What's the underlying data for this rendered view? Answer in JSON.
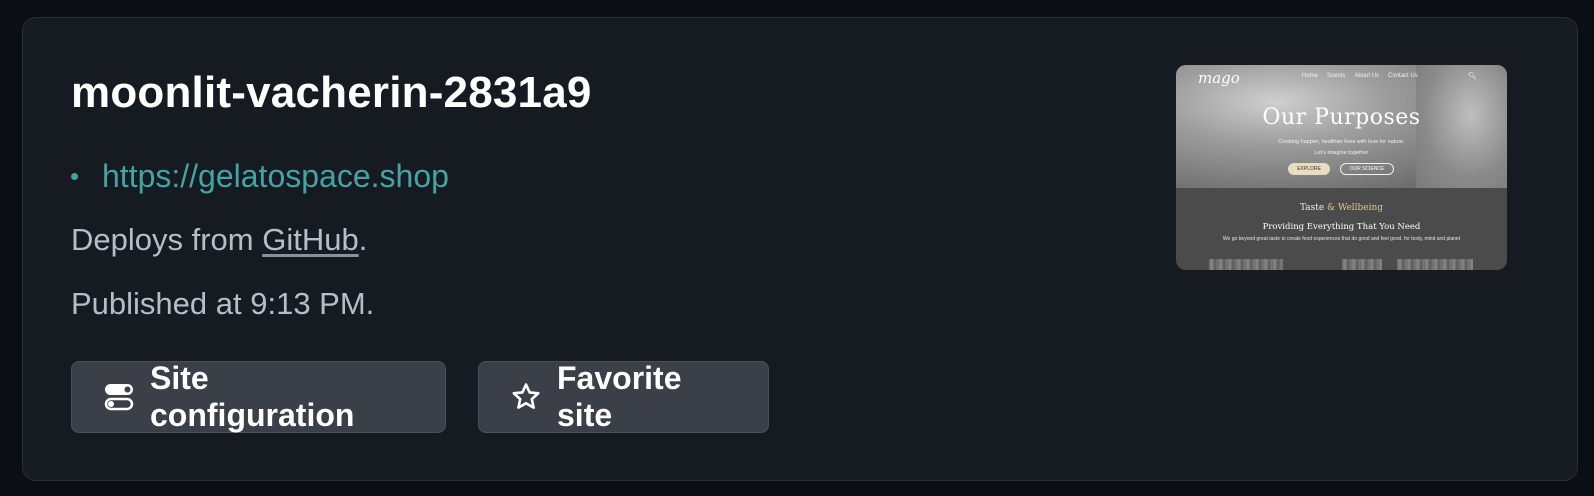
{
  "site": {
    "name": "moonlit-vacherin-2831a9",
    "url": "https://gelatospace.shop",
    "deploys_prefix": "Deploys from ",
    "deploys_source": "GitHub",
    "deploys_suffix": ".",
    "published": "Published at 9:13 PM."
  },
  "buttons": {
    "config": {
      "label": "Site configuration",
      "icon": "toggles-icon"
    },
    "favorite": {
      "label": "Favorite site",
      "icon": "star-icon"
    }
  },
  "thumbnail": {
    "logo": "mago",
    "nav": [
      "Home",
      "Scents",
      "About Us",
      "Contact Us"
    ],
    "heading": "Our Purposes",
    "tagline1": "Creating happier, healthier lives with love for nature.",
    "tagline2": "Let's imagine together",
    "primary_button": "EXPLORE",
    "secondary_button": "OUR SCIENCE",
    "taste_word": "Taste",
    "taste_amp": "&",
    "taste_word2": "Wellbeing",
    "providing": "Providing Everything That You Need",
    "description": "We go beyond great taste to create food experiences that do good and feel good, for body, mind and planet"
  },
  "colors": {
    "background": "#0b0e13",
    "card": "#161a21",
    "link": "#44a3a3",
    "button": "#3a3f48",
    "muted_text": "#b8bcc4"
  }
}
